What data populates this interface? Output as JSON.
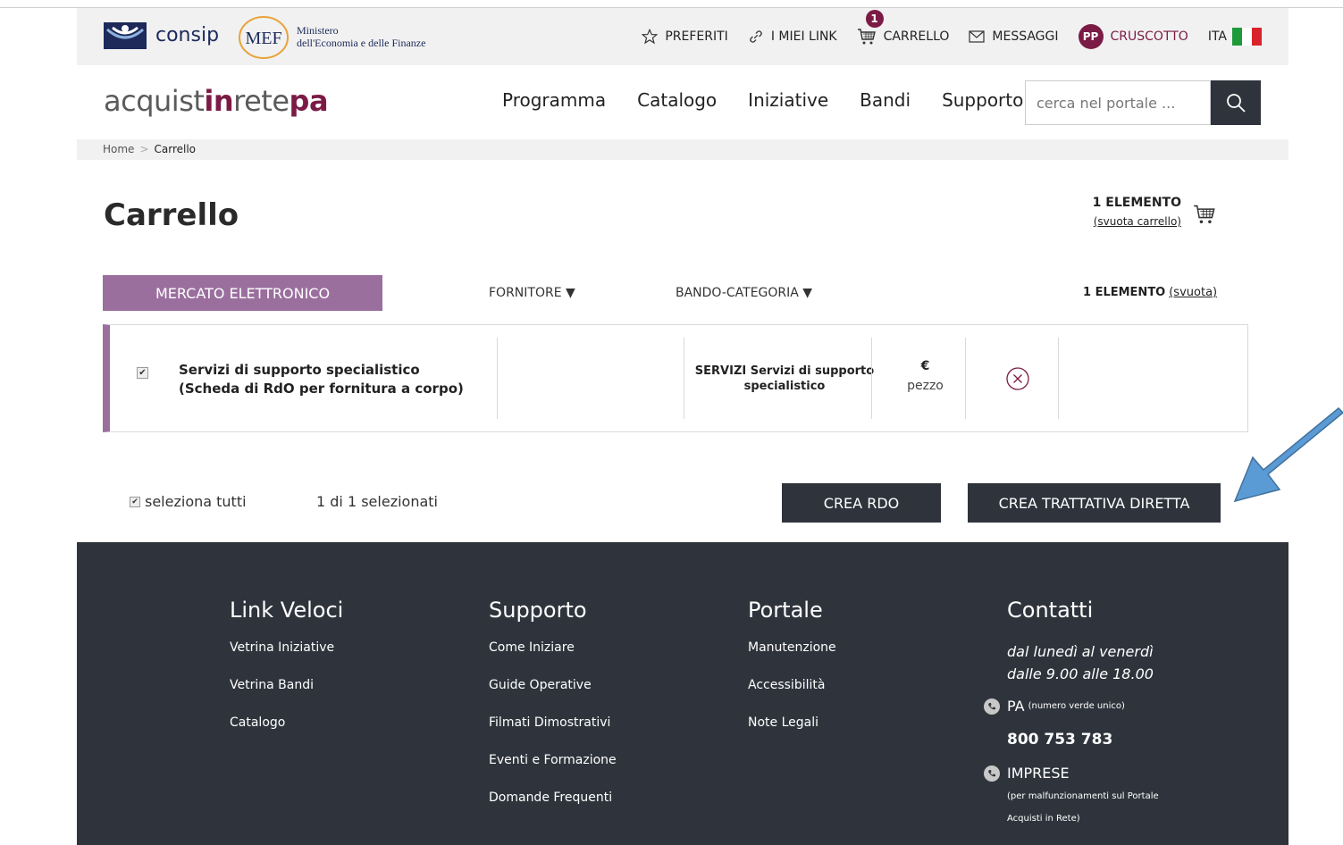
{
  "utility": {
    "consip_label": "consip",
    "mef_abbr": "MEF",
    "mef_line1": "Ministero",
    "mef_line2": "dell'Economia e delle Finanze",
    "links": {
      "preferiti": "PREFERITI",
      "miei_link": "I MIEI LINK",
      "carrello": "CARRELLO",
      "messaggi": "MESSAGGI",
      "cruscotto": "CRUSCOTTO",
      "lang": "ITA"
    },
    "cart_badge": "1",
    "user_initials": "PP"
  },
  "header": {
    "brand_part1": "acquist",
    "brand_part2": "in",
    "brand_part3": "rete",
    "brand_part4": "pa",
    "nav": [
      "Programma",
      "Catalogo",
      "Iniziative",
      "Bandi",
      "Supporto"
    ],
    "search_placeholder": "cerca nel portale ..."
  },
  "breadcrumb": {
    "home": "Home",
    "separator": ">",
    "current": "Carrello"
  },
  "page": {
    "title": "Carrello",
    "summary_count": "1 ELEMENTO",
    "summary_empty": "(svuota carrello)"
  },
  "group": {
    "tab_label": "MERCATO ELETTRONICO",
    "sort_fornitore": "FORNITORE ▼",
    "sort_bando": "BANDO-CATEGORIA ▼",
    "count": "1 ELEMENTO",
    "empty_link": "(svuota)"
  },
  "item": {
    "title": "Servizi di supporto specialistico (Scheda di RdO per fornitura a corpo)",
    "category": "SERVIZI Servizi di supporto specialistico",
    "currency": "€",
    "unit": "pezzo",
    "checked": true
  },
  "actions": {
    "select_all": "seleziona tutti",
    "selected_count": "1 di 1 selezionati",
    "crea_rdo": "CREA RDO",
    "crea_td": "CREA TRATTATIVA DIRETTA"
  },
  "footer": {
    "col1": {
      "title": "Link Veloci",
      "links": [
        "Vetrina Iniziative",
        "Vetrina Bandi",
        "Catalogo"
      ]
    },
    "col2": {
      "title": "Supporto",
      "links": [
        "Come Iniziare",
        "Guide Operative",
        "Filmati Dimostrativi",
        "Eventi e Formazione",
        "Domande Frequenti"
      ]
    },
    "col3": {
      "title": "Portale",
      "links": [
        "Manutenzione",
        "Accessibilità",
        "Note Legali"
      ]
    },
    "col4": {
      "title": "Contatti",
      "hours_line1": "dal lunedì al venerdì",
      "hours_line2": "dalle 9.00 alle 18.00",
      "pa_label": "PA",
      "pa_note": "(numero verde unico)",
      "pa_number": "800 753 783",
      "imprese_label": "IMPRESE",
      "imprese_note_line1": "(per malfunzionamenti sul Portale",
      "imprese_note_line2": "Acquisti in Rete)"
    }
  },
  "colors": {
    "brand_purple": "#7b1b45",
    "tab_mauve": "#9a6f9e",
    "dark": "#2f343c",
    "arrow_blue": "#5b9bd5"
  }
}
